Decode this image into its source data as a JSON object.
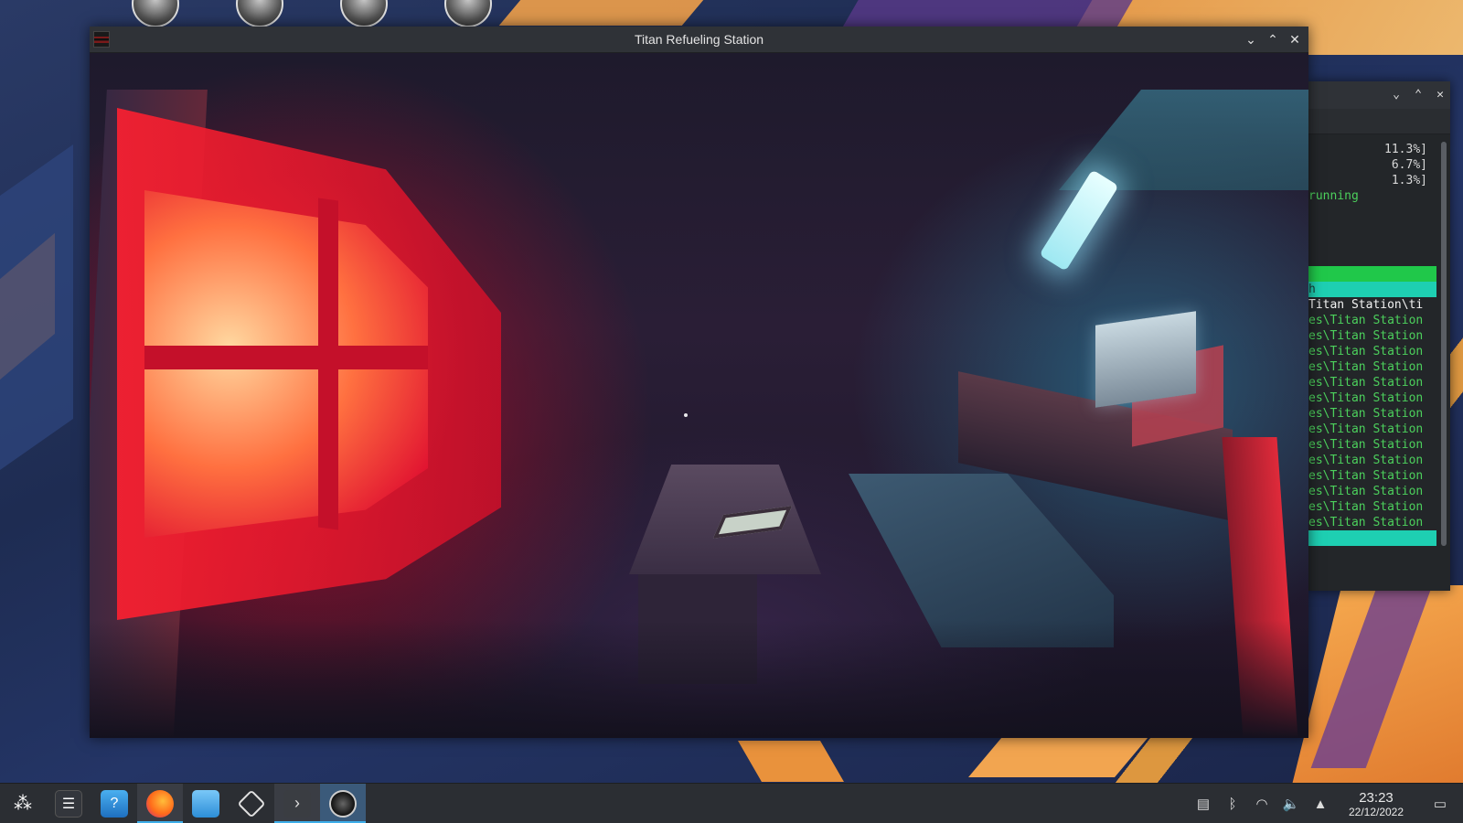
{
  "window": {
    "title": "Titan Refueling Station"
  },
  "terminal": {
    "lines_top": [
      "11.3%]",
      "6.7%]",
      "1.3%]"
    ],
    "status": "running",
    "teal_text": "h",
    "path_white": "Titan Station\\ti",
    "path_green": "es\\Titan Station",
    "path_green_count": 14
  },
  "taskbar": {
    "items": [
      {
        "name": "application-launcher",
        "icon": "launcher-icon",
        "glyph": "⁂"
      },
      {
        "name": "system-settings",
        "icon": "sliders-icon",
        "glyph": "☰"
      },
      {
        "name": "discover-store",
        "icon": "shopping-bag-icon",
        "glyph": "?"
      },
      {
        "name": "firefox",
        "icon": "firefox-icon",
        "glyph": ""
      },
      {
        "name": "file-manager",
        "icon": "folder-icon",
        "glyph": ""
      },
      {
        "name": "steam",
        "icon": "steam-icon",
        "glyph": ""
      },
      {
        "name": "terminal",
        "icon": "terminal-icon",
        "glyph": "›"
      },
      {
        "name": "game",
        "icon": "game-icon",
        "glyph": ""
      }
    ],
    "clock": {
      "time": "23:23",
      "date": "22/12/2022"
    }
  },
  "colors": {
    "accent": "#3daee9",
    "terminal_green": "#4cd05c",
    "terminal_bar_green": "#20c84a",
    "terminal_bar_teal": "#1ecfb2"
  }
}
